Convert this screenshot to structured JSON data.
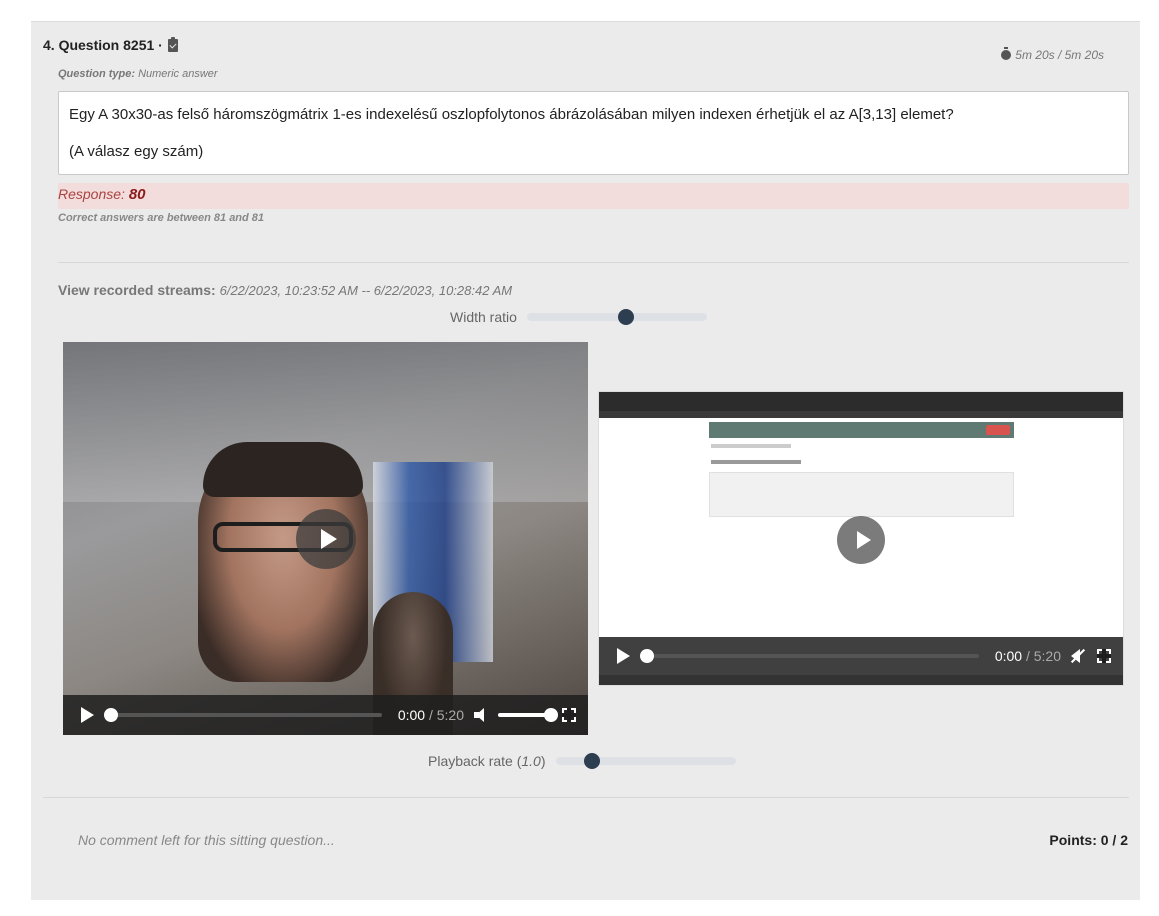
{
  "question": {
    "number_title": "4. Question 8251 ·",
    "type_label": "Question type:",
    "type_value": "Numeric answer",
    "timer": "5m 20s / 5m 20s",
    "text_line1": "Egy A 30x30-as felső háromszögmátrix 1-es indexelésű oszlopfolytonos ábrázolásában milyen indexen érhetjük el az A[3,13] elemet?",
    "text_line2": "(A válasz egy szám)"
  },
  "response": {
    "label": "Response:",
    "value": "80",
    "correct_note": "Correct answers are between 81 and 81"
  },
  "streams": {
    "label": "View recorded streams:",
    "range": "6/22/2023, 10:23:52 AM -- 6/22/2023, 10:28:42 AM"
  },
  "width_ratio": {
    "label": "Width ratio",
    "value": 0.55
  },
  "playback_rate": {
    "label": "Playback rate (",
    "value_text": "1.0",
    "label_end": ")",
    "value": 0.2
  },
  "video1": {
    "current": "0:00",
    "separator": " / ",
    "duration": "5:20",
    "volume": 1.0
  },
  "video2": {
    "current": "0:00",
    "separator": " / ",
    "duration": "5:20"
  },
  "comment": "No comment left for this sitting question...",
  "points": "Points: 0 / 2",
  "icons": {
    "clipboard": "clipboard-check-icon",
    "timer": "stopwatch-icon"
  }
}
